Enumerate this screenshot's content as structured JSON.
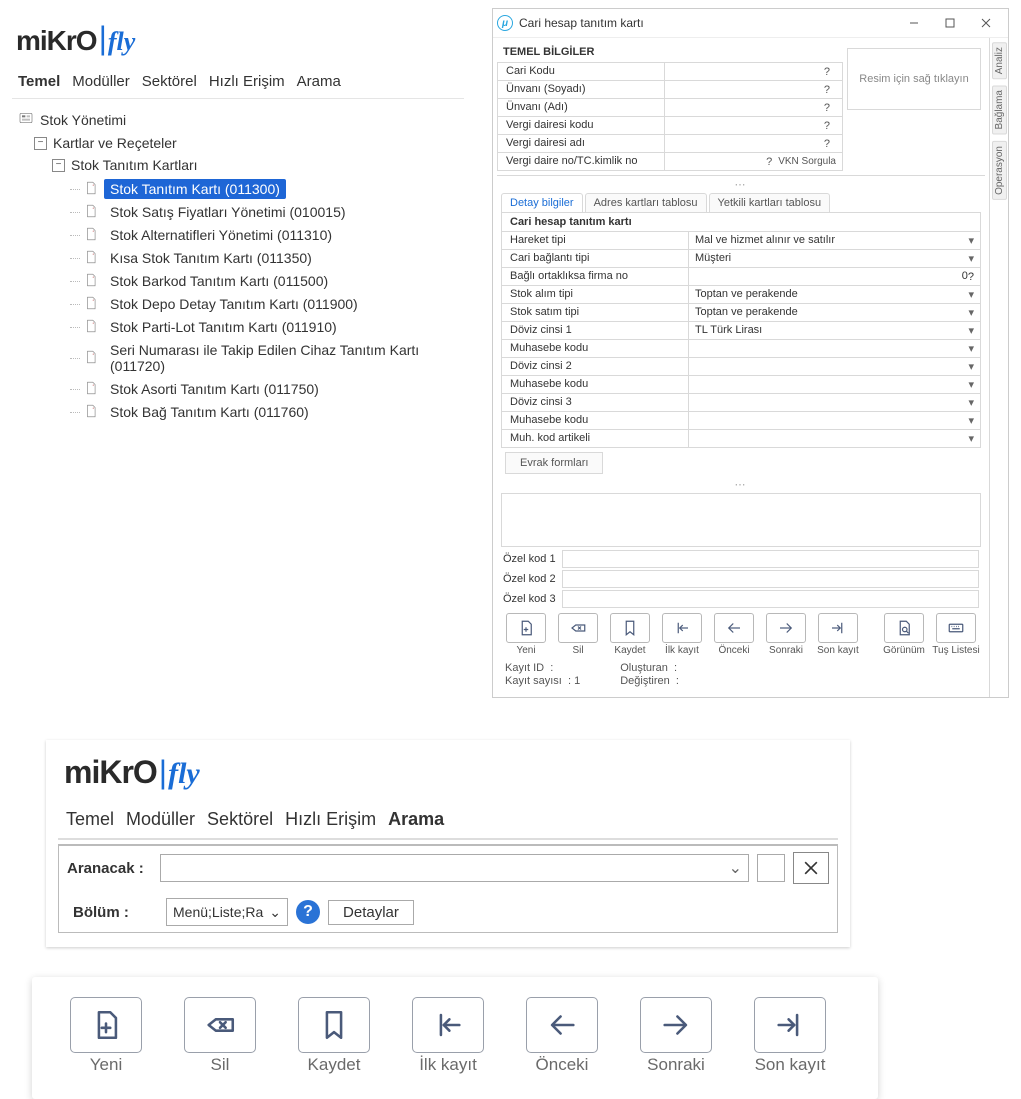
{
  "brand": {
    "word1": "miKrO",
    "word2": "fly"
  },
  "menu": {
    "items": [
      "Temel",
      "Modüller",
      "Sektörel",
      "Hızlı Erişim",
      "Arama"
    ]
  },
  "tree": {
    "root": "Stok Yönetimi",
    "group": "Kartlar ve Reçeteler",
    "subgroup": "Stok Tanıtım Kartları",
    "leaves": [
      "Stok Tanıtım Kartı (011300)",
      "Stok Satış Fiyatları Yönetimi (010015)",
      "Stok Alternatifleri Yönetimi (011310)",
      "Kısa Stok Tanıtım Kartı (011350)",
      "Stok Barkod Tanıtım Kartı (011500)",
      "Stok Depo Detay Tanıtım Kartı (011900)",
      "Stok Parti-Lot Tanıtım Kartı (011910)",
      "Seri Numarası ile Takip Edilen Cihaz Tanıtım Kartı (011720)",
      "Stok Asorti Tanıtım Kartı (011750)",
      "Stok Bağ Tanıtım Kartı (011760)"
    ]
  },
  "dialog": {
    "title": "Cari hesap tanıtım kartı",
    "section_basic": "TEMEL BİLGİLER",
    "basic_fields": [
      {
        "k": "Cari Kodu",
        "v": "",
        "q": "?"
      },
      {
        "k": "Ünvanı (Soyadı)",
        "v": "",
        "q": "?"
      },
      {
        "k": "Ünvanı (Adı)",
        "v": "",
        "q": "?"
      },
      {
        "k": "Vergi dairesi kodu",
        "v": "",
        "q": "?"
      },
      {
        "k": "Vergi dairesi adı",
        "v": "",
        "q": "?"
      },
      {
        "k": "Vergi daire no/TC.kimlik no",
        "v": "",
        "q": "?",
        "extra": "VKN Sorgula"
      }
    ],
    "image_hint": "Resim için sağ tıklayın",
    "tabs": [
      "Detay bilgiler",
      "Adres kartları tablosu",
      "Yetkili kartları tablosu"
    ],
    "detail_title": "Cari hesap tanıtım kartı",
    "detail_fields": [
      {
        "k": "Hareket tipi",
        "v": "Mal ve hizmet alınır ve satılır"
      },
      {
        "k": "Cari bağlantı tipi",
        "v": "Müşteri"
      },
      {
        "k": "Bağlı ortaklıksa firma no",
        "v": "0",
        "q": "?"
      },
      {
        "k": "Stok alım tipi",
        "v": "Toptan ve perakende"
      },
      {
        "k": "Stok satım tipi",
        "v": "Toptan ve perakende"
      },
      {
        "k": "Döviz cinsi 1",
        "v": "TL Türk Lirası"
      },
      {
        "k": "Muhasebe kodu",
        "v": ""
      },
      {
        "k": "Döviz cinsi 2",
        "v": ""
      },
      {
        "k": "Muhasebe kodu",
        "v": ""
      },
      {
        "k": "Döviz cinsi 3",
        "v": ""
      },
      {
        "k": "Muhasebe kodu",
        "v": ""
      },
      {
        "k": "Muh. kod artikeli",
        "v": ""
      }
    ],
    "evrak_btn": "Evrak formları",
    "ozel": [
      "Özel kod 1",
      "Özel kod 2",
      "Özel kod 3"
    ],
    "toolbar": {
      "yeni": "Yeni",
      "sil": "Sil",
      "kaydet": "Kaydet",
      "ilk": "İlk kayıt",
      "onceki": "Önceki",
      "sonraki": "Sonraki",
      "son": "Son kayıt",
      "gorunum": "Görünüm",
      "tus": "Tuş Listesi"
    },
    "status": {
      "kayit_id_label": "Kayıt ID",
      "kayit_id": ":",
      "kayit_sayisi_label": "Kayıt sayısı",
      "kayit_sayisi": ": 1",
      "olusturan_label": "Oluşturan",
      "olusturan": ":",
      "degistiren_label": "Değiştiren",
      "degistiren": ":"
    },
    "sidetabs": [
      "Analiz",
      "Bağlama",
      "Operasyon"
    ]
  },
  "search": {
    "aranacak_label": "Aranacak :",
    "bolum_label": "Bölüm :",
    "bolum_value": "Menü;Liste;Ra",
    "detaylar": "Detaylar"
  },
  "bigtoolbar": {
    "yeni": "Yeni",
    "sil": "Sil",
    "kaydet": "Kaydet",
    "ilk": "İlk kayıt",
    "onceki": "Önceki",
    "sonraki": "Sonraki",
    "son": "Son kayıt"
  }
}
